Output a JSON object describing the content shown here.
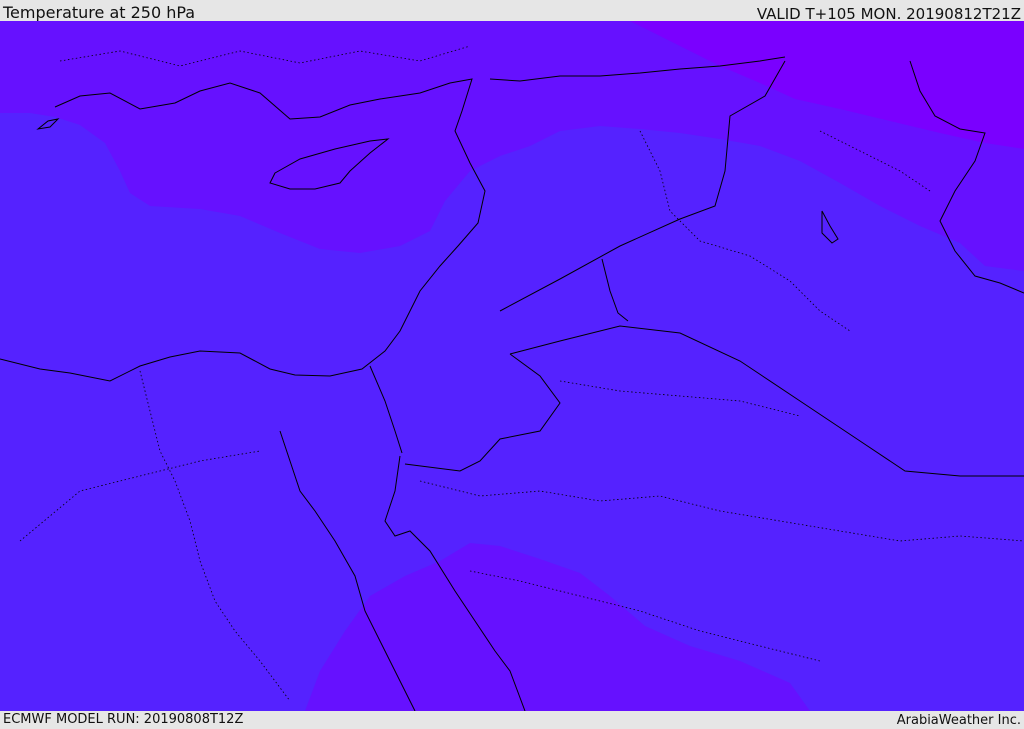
{
  "header": {
    "title": "Temperature at 250 hPa",
    "valid": "VALID T+105 MON. 20190812T21Z"
  },
  "footer": {
    "model_run": "ECMWF MODEL RUN: 20190808T12Z",
    "credit": "ArabiaWeather Inc."
  },
  "map": {
    "colors": {
      "warm_band": "#5522ff",
      "mid_band": "#6611ff",
      "cold_band": "#7a00ff",
      "coastline": "#000000"
    }
  }
}
